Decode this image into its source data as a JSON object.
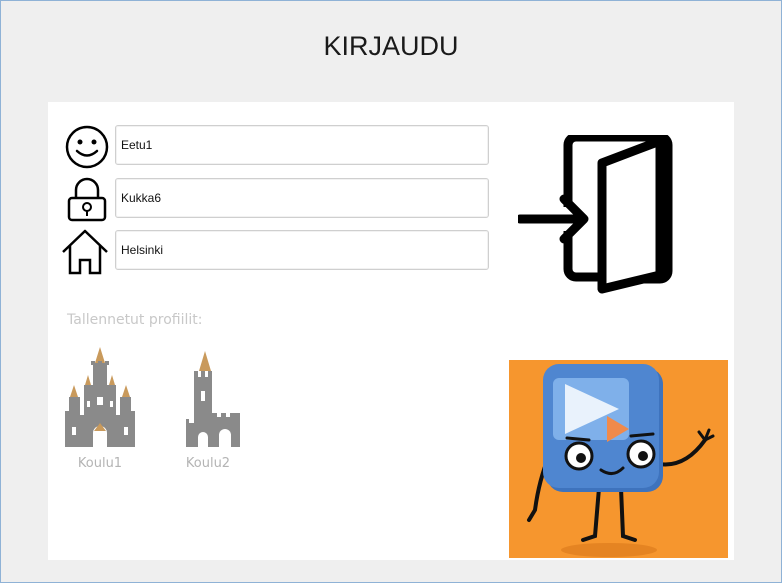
{
  "header": {
    "title": "KIRJAUDU"
  },
  "form": {
    "username_value": "Eetu1",
    "password_value": "Kukka6",
    "location_value": "Helsinki"
  },
  "saved_profiles": {
    "label": "Tallennetut profiilit:",
    "items": [
      {
        "name": "Koulu1",
        "icon": "castle-icon"
      },
      {
        "name": "Koulu2",
        "icon": "tower-icon"
      }
    ]
  },
  "icons": {
    "user": "smiley-face-icon",
    "password": "padlock-icon",
    "location": "house-icon",
    "login": "login-door-icon"
  },
  "colors": {
    "mascot_background": "#f6962e",
    "mascot_body": "#4f86d0",
    "castle_gray": "#8a8a8a",
    "roof_tan": "#c99a5c"
  }
}
